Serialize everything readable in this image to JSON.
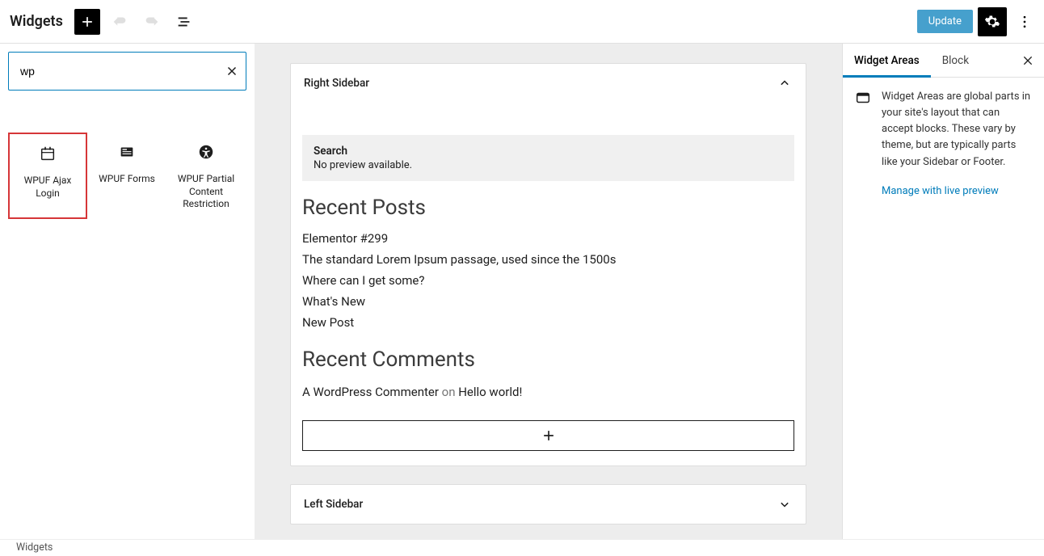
{
  "header": {
    "title": "Widgets",
    "update_label": "Update"
  },
  "inserter": {
    "search_value": "wp",
    "blocks": [
      {
        "label": "WPUF Ajax Login",
        "icon": "calendar"
      },
      {
        "label": "WPUF Forms",
        "icon": "card"
      },
      {
        "label": "WPUF Partial Content Restriction",
        "icon": "access"
      }
    ]
  },
  "canvas": {
    "areas": [
      {
        "name": "Right Sidebar",
        "expanded": true,
        "search_block": {
          "title": "Search",
          "subtitle": "No preview available."
        },
        "recent_posts": {
          "heading": "Recent Posts",
          "items": [
            "Elementor #299",
            "The standard Lorem Ipsum passage, used since the 1500s",
            "Where can I get some?",
            "What's New",
            "New Post"
          ]
        },
        "recent_comments": {
          "heading": "Recent Comments",
          "items": [
            {
              "author": "A WordPress Commenter",
              "on": " on ",
              "post": "Hello world!"
            }
          ]
        }
      },
      {
        "name": "Left Sidebar",
        "expanded": false
      }
    ]
  },
  "sidepanel": {
    "tabs": {
      "areas": "Widget Areas",
      "block": "Block"
    },
    "description": "Widget Areas are global parts in your site's layout that can accept blocks. These vary by theme, but are typically parts like your Sidebar or Footer.",
    "link": "Manage with live preview"
  },
  "footer": {
    "breadcrumb": "Widgets"
  }
}
